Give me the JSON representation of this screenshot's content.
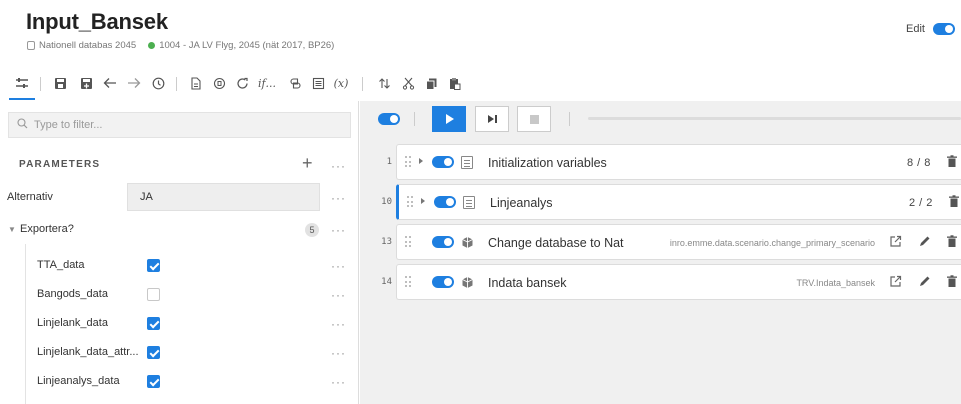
{
  "colors": {
    "accent": "#1e7fe0",
    "status_green": "#4caf50"
  },
  "header": {
    "title": "Input_Bansek",
    "database": "Nationell databas 2045",
    "scenario": "1004 - JA LV Flyg, 2045 (nät 2017, BP26)",
    "edit_label": "Edit",
    "edit_on": true
  },
  "toolbar": {
    "function_label": "𝑖𝑓...",
    "variable_label": "(x)",
    "icons": [
      "sliders-icon",
      "save-icon",
      "save-as-icon",
      "undo-icon",
      "redo-icon",
      "history-icon",
      "document-icon",
      "copy-settings-icon",
      "refresh-icon",
      "function-icon",
      "link-icon",
      "list-icon",
      "variable-icon",
      "sort-icon",
      "cut-icon",
      "copy-icon",
      "paste-icon"
    ]
  },
  "left_panel": {
    "filter_placeholder": "Type to filter...",
    "parameters_heading": "PARAMETERS",
    "alternativ": {
      "label": "Alternativ",
      "value": "JA"
    },
    "exportera": {
      "label": "Exportera?",
      "count": "5"
    },
    "exports": [
      {
        "label": "TTA_data",
        "checked": true
      },
      {
        "label": "Bangods_data",
        "checked": false
      },
      {
        "label": "Linjelank_data",
        "checked": true
      },
      {
        "label": "Linjelank_data_attr...",
        "checked": true
      },
      {
        "label": "Linjeanalys_data",
        "checked": true
      }
    ]
  },
  "steps": [
    {
      "number": "1",
      "title": "Initialization variables",
      "count": "8 / 8",
      "icon": "list-icon"
    },
    {
      "number": "10",
      "title": "Linjeanalys",
      "count": "2 / 2",
      "icon": "list-icon"
    },
    {
      "number": "13",
      "title": "Change database to Nat",
      "ref": "inro.emme.data.scenario.change_primary_scenario",
      "icon": "tool-icon"
    },
    {
      "number": "14",
      "title": "Indata bansek",
      "ref": "TRV.Indata_bansek",
      "icon": "tool-icon"
    }
  ]
}
